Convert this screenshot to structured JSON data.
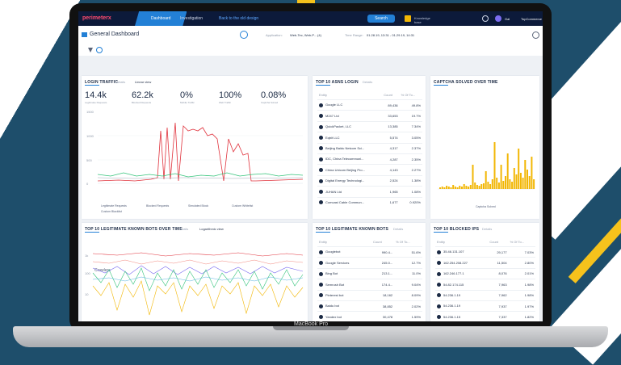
{
  "colors": {
    "accent": "#2380d6",
    "topbar": "#0c1a3a",
    "brand": "#ff4b6e",
    "red": "#e0323c",
    "green": "#35c47b",
    "yellow": "#f2b705"
  },
  "topbar": {
    "logo": "perimeterx",
    "tabs": [
      "Dashboard",
      "Investigation"
    ],
    "back_link": "Back to the old design",
    "search_label": "Search",
    "knowledge": "Knowledge base",
    "user": "Gal",
    "company": "TopCommerce"
  },
  "header": {
    "title": "General Dashboard",
    "application_label": "Application:",
    "application_value": "Web-Tec, Web-P...  (4)",
    "time_label": "Time Range:",
    "time_value": "01.28.19, 13:31 - 01.29.19, 14:31"
  },
  "login_traffic": {
    "title": "LOGIN TRAFFIC",
    "meta": "Details",
    "view": "Linear view",
    "kpis": [
      {
        "value": "14.4k",
        "label": "Legitimate Requests"
      },
      {
        "value": "62.2k",
        "label": "Blocked Requests"
      },
      {
        "value": "0%",
        "label": "Mobile Traffic"
      },
      {
        "value": "100%",
        "label": "Web Traffic"
      },
      {
        "value": "0.08%",
        "label": "Captcha Solved"
      }
    ],
    "y_ticks": [
      "1500",
      "1000",
      "500",
      "0"
    ],
    "legend": [
      "Legitimate Requests",
      "Blocked Requests",
      "Simulated Block",
      "Custom Whitelist",
      "Custom Blacklist"
    ]
  },
  "top_asn": {
    "title": "TOP 10 ASNS LOGIN",
    "meta": "Details",
    "headers": [
      "Entity",
      "Count",
      "% Of To..."
    ],
    "rows": [
      [
        "Google LLC",
        "89,436",
        "49.8%"
      ],
      [
        "M247 Ltd",
        "33,653",
        "19.7%"
      ],
      [
        "QuickPacket, LLC",
        "13,385",
        "7.34%"
      ],
      [
        "Eqbit LLC",
        "5,574",
        "3.05%"
      ],
      [
        "Beijing Baidu Netcom Sci...",
        "4,317",
        "2.37%"
      ],
      [
        "IDC, China Telecommuni...",
        "4,287",
        "2.35%"
      ],
      [
        "China Unicom Beijing Pro...",
        "4,143",
        "2.27%"
      ],
      [
        "Digital Energy Technologi...",
        "2,524",
        "1.38%"
      ],
      [
        "JUHAN Ltd",
        "1,965",
        "1.08%"
      ],
      [
        "Comcast Cable Commun...",
        "1,677",
        "0.920%"
      ]
    ]
  },
  "captcha": {
    "title": "CAPTCHA SOLVED OVER TIME",
    "legend": "Captcha Solved"
  },
  "legit_bots": {
    "title": "TOP 10 LEGITIMATE KNOWN BOTS OVER TIME",
    "meta": "Details",
    "view": "Logarithmic view",
    "y_ticks": [
      "1k",
      "100",
      "10"
    ],
    "annotation": "Crawlers"
  },
  "known_bots": {
    "title": "TOP 10 LEGITIMATE KNOWN BOTS",
    "meta": "Details",
    "headers": [
      "Entity",
      "Count",
      "% Of To..."
    ],
    "rows": [
      [
        "Googlebot",
        "990.4...",
        "51.6%"
      ],
      [
        "Google Services",
        "245.0...",
        "12.7%"
      ],
      [
        "Bing Bot",
        "213.1...",
        "11.0%"
      ],
      [
        "Semrush Bot",
        "174.4...",
        "9.04%"
      ],
      [
        "Pinterest bot",
        "18,162",
        "8.09%"
      ],
      [
        "Baidu bot",
        "38,852",
        "2.02%"
      ],
      [
        "Yandex bot",
        "30,478",
        "1.59%"
      ]
    ]
  },
  "blocked_ips": {
    "title": "TOP 10 BLOCKED IPS",
    "meta": "Details",
    "headers": [
      "Entity",
      "Count",
      "% Of To..."
    ],
    "rows": [
      [
        "35.46.131.107",
        "29,177",
        "7.03%"
      ],
      [
        "162.254.208.227",
        "11,504",
        "2.80%"
      ],
      [
        "162.246.177.1",
        "8,076",
        "2.01%"
      ],
      [
        "54.82.174.115",
        "7,963",
        "1.98%"
      ],
      [
        "54.236.1.19",
        "7,962",
        "1.98%"
      ],
      [
        "54.236.1.19",
        "7,937",
        "1.97%"
      ],
      [
        "54.236.1.15",
        "7,337",
        "1.82%"
      ]
    ]
  },
  "laptop": {
    "label": "MacBook Pro"
  }
}
